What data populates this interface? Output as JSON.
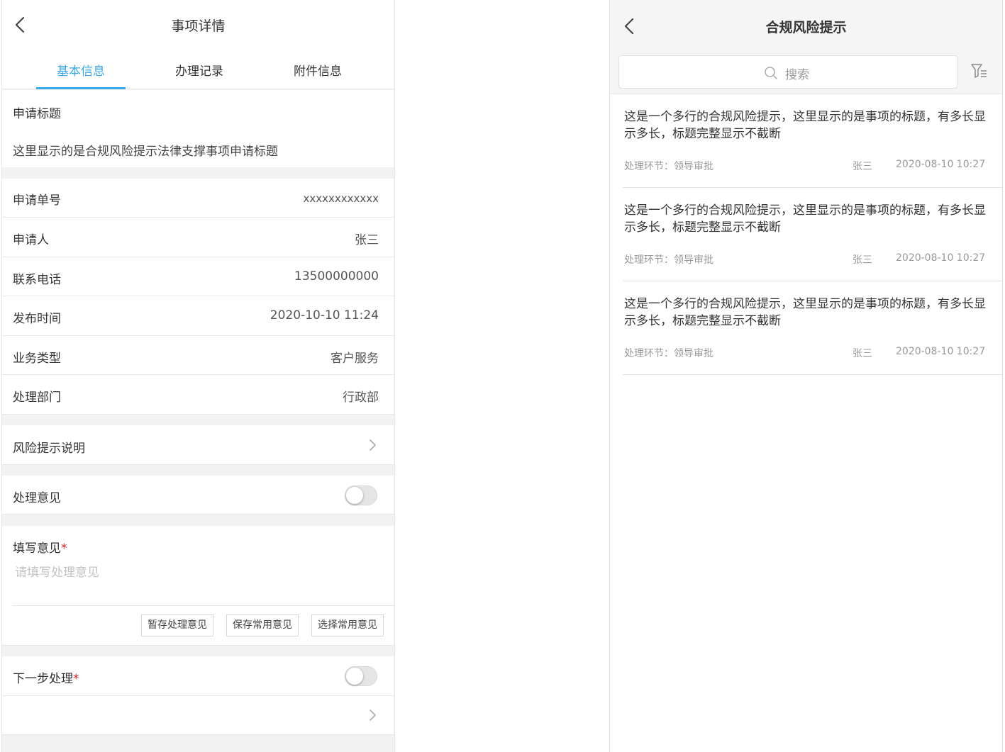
{
  "left": {
    "header": {
      "title": "事项详情"
    },
    "tabs": [
      "基本信息",
      "办理记录",
      "附件信息"
    ],
    "apply_title": {
      "label": "申请标题",
      "value": "这里显示的是合规风险提示法律支撑事项申请标题"
    },
    "fields": [
      {
        "label": "申请单号",
        "value": "xxxxxxxxxxxx"
      },
      {
        "label": "申请人",
        "value": "张三"
      },
      {
        "label": "联系电话",
        "value": "13500000000"
      },
      {
        "label": "发布时间",
        "value": "2020-10-10 11:24"
      },
      {
        "label": "业务类型",
        "value": "客户服务"
      },
      {
        "label": "处理部门",
        "value": "行政部"
      }
    ],
    "risk_note": {
      "label": "风险提示说明"
    },
    "opinion_toggle": {
      "label": "处理意见"
    },
    "opinion_form": {
      "label": "填写意见",
      "required_mark": "*",
      "placeholder": "请填写处理意见",
      "buttons": [
        "暂存处理意见",
        "保存常用意见",
        "选择常用意见"
      ]
    },
    "next_step": {
      "label": "下一步处理",
      "required_mark": "*"
    }
  },
  "right": {
    "header": {
      "title": "合规风险提示"
    },
    "search": {
      "placeholder": "搜索"
    },
    "items": [
      {
        "title": "这是一个多行的合规风险提示，这里显示的是事项的标题，有多长显示多长，标题完整显示不截断",
        "stage": "处理环节：领导审批",
        "person": "张三",
        "time": "2020-08-10 10:27"
      },
      {
        "title": "这是一个多行的合规风险提示，这里显示的是事项的标题，有多长显示多长，标题完整显示不截断",
        "stage": "处理环节：领导审批",
        "person": "张三",
        "time": "2020-08-10 10:27"
      },
      {
        "title": "这是一个多行的合规风险提示，这里显示的是事项的标题，有多长显示多长，标题完整显示不截断",
        "stage": "处理环节：领导审批",
        "person": "张三",
        "time": "2020-08-10 10:27"
      }
    ]
  },
  "colors": {
    "accent": "#3ba7e6",
    "required": "#e02020",
    "separator": "#f2f2f2"
  }
}
